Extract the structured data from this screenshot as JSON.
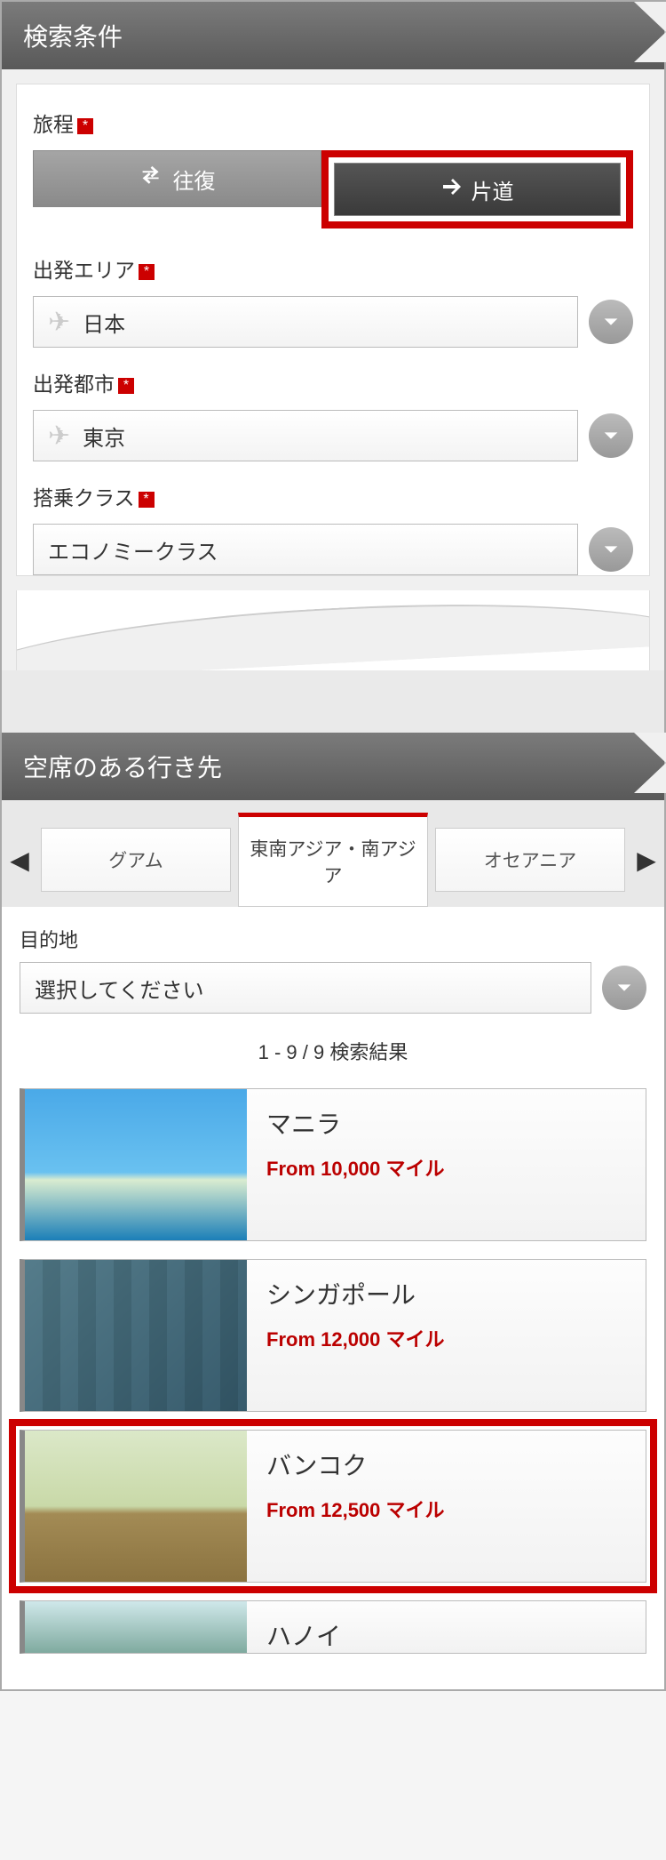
{
  "search": {
    "header": "検索条件",
    "trip_label": "旅程",
    "roundtrip": "往復",
    "oneway": "片道",
    "depart_area_label": "出発エリア",
    "depart_area_value": "日本",
    "depart_city_label": "出発都市",
    "depart_city_value": "東京",
    "cabin_label": "搭乗クラス",
    "cabin_value": "エコノミークラス"
  },
  "availability": {
    "header": "空席のある行き先",
    "tabs": [
      "グアム",
      "東南アジア・南アジア",
      "オセアニア"
    ],
    "dest_label": "目的地",
    "dest_placeholder": "選択してください",
    "results_count_text": "1 - 9 / 9 検索結果",
    "cards": [
      {
        "title": "マニラ",
        "price": "From 10,000 マイル"
      },
      {
        "title": "シンガポール",
        "price": "From 12,000 マイル"
      },
      {
        "title": "バンコク",
        "price": "From 12,500 マイル"
      },
      {
        "title": "ハノイ",
        "price": ""
      }
    ]
  }
}
